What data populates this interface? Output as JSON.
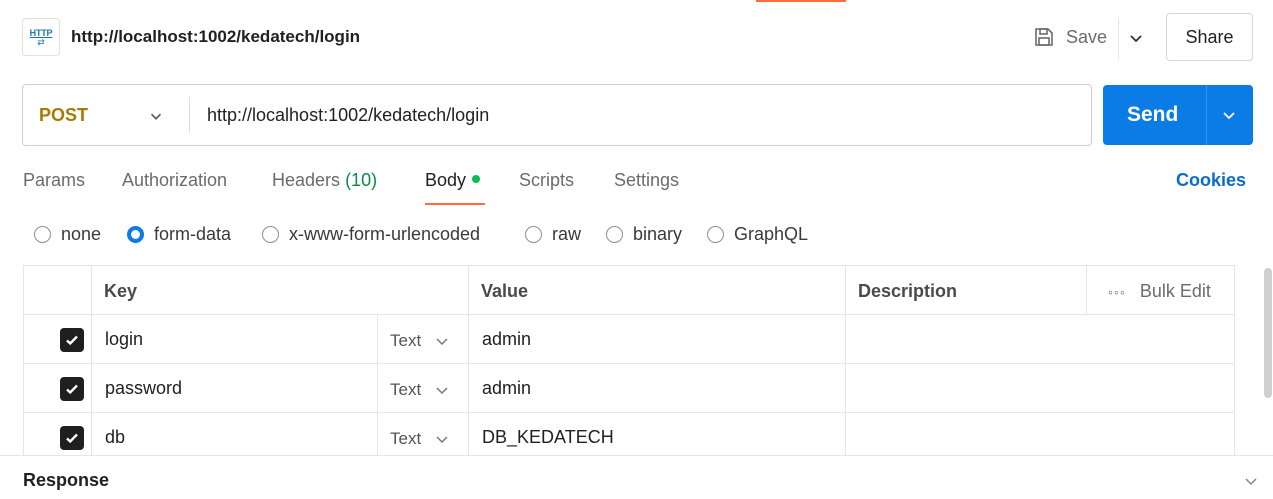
{
  "header": {
    "icon_text": "HTTP",
    "title": "http://localhost:1002/kedatech/login",
    "save_label": "Save",
    "share_label": "Share"
  },
  "request": {
    "method": "POST",
    "url": "http://localhost:1002/kedatech/login",
    "send_label": "Send"
  },
  "tabs": [
    {
      "label": "Params"
    },
    {
      "label": "Authorization"
    },
    {
      "label": "Headers",
      "count": "(10)"
    },
    {
      "label": "Body",
      "active": true
    },
    {
      "label": "Scripts"
    },
    {
      "label": "Settings"
    }
  ],
  "cookies_label": "Cookies",
  "body_types": [
    {
      "label": "none"
    },
    {
      "label": "form-data",
      "selected": true
    },
    {
      "label": "x-www-form-urlencoded"
    },
    {
      "label": "raw"
    },
    {
      "label": "binary"
    },
    {
      "label": "GraphQL"
    }
  ],
  "table": {
    "headers": {
      "key": "Key",
      "value": "Value",
      "description": "Description",
      "bulk_edit": "Bulk Edit"
    },
    "rows": [
      {
        "checked": true,
        "key": "login",
        "type": "Text",
        "value": "admin",
        "description": ""
      },
      {
        "checked": true,
        "key": "password",
        "type": "Text",
        "value": "admin",
        "description": ""
      },
      {
        "checked": true,
        "key": "db",
        "type": "Text",
        "value": "DB_KEDATECH",
        "description": ""
      }
    ]
  },
  "response_label": "Response",
  "colors": {
    "accent": "#ff6c37",
    "send": "#0b7ce6",
    "method": "#a87a00",
    "headers_count": "#0c8b47",
    "body_dot": "#0cbb52",
    "cookies": "#0b6bcb"
  }
}
